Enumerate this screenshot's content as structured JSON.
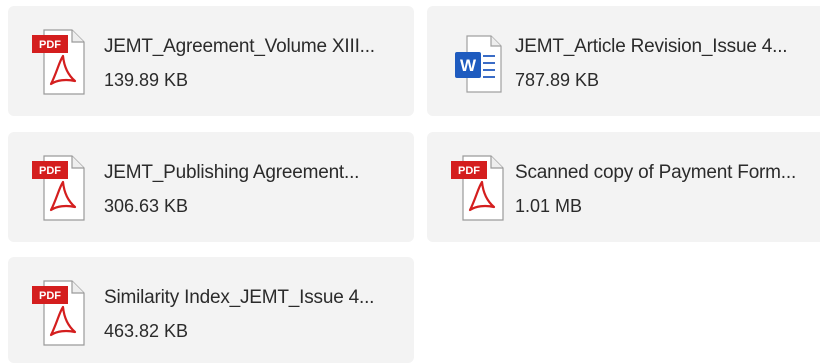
{
  "attachments": [
    {
      "name": "JEMT_Agreement_Volume XIII...",
      "size": "139.89 KB",
      "type_icon": "pdf-file-icon",
      "badge": "PDF"
    },
    {
      "name": "JEMT_Article Revision_Issue 4...",
      "size": "787.89 KB",
      "type_icon": "word-file-icon",
      "badge": "W"
    },
    {
      "name": "JEMT_Publishing Agreement...",
      "size": "306.63 KB",
      "type_icon": "pdf-file-icon",
      "badge": "PDF"
    },
    {
      "name": "Scanned copy of Payment Form...",
      "size": "1.01 MB",
      "type_icon": "pdf-file-icon",
      "badge": "PDF"
    },
    {
      "name": "Similarity Index_JEMT_Issue 4...",
      "size": "463.82 KB",
      "type_icon": "pdf-file-icon",
      "badge": "PDF"
    }
  ],
  "colors": {
    "card_background": "#f3f3f3",
    "pdf_red": "#d41e1e",
    "word_blue": "#1e5bbf",
    "text": "#2b2b2b"
  }
}
